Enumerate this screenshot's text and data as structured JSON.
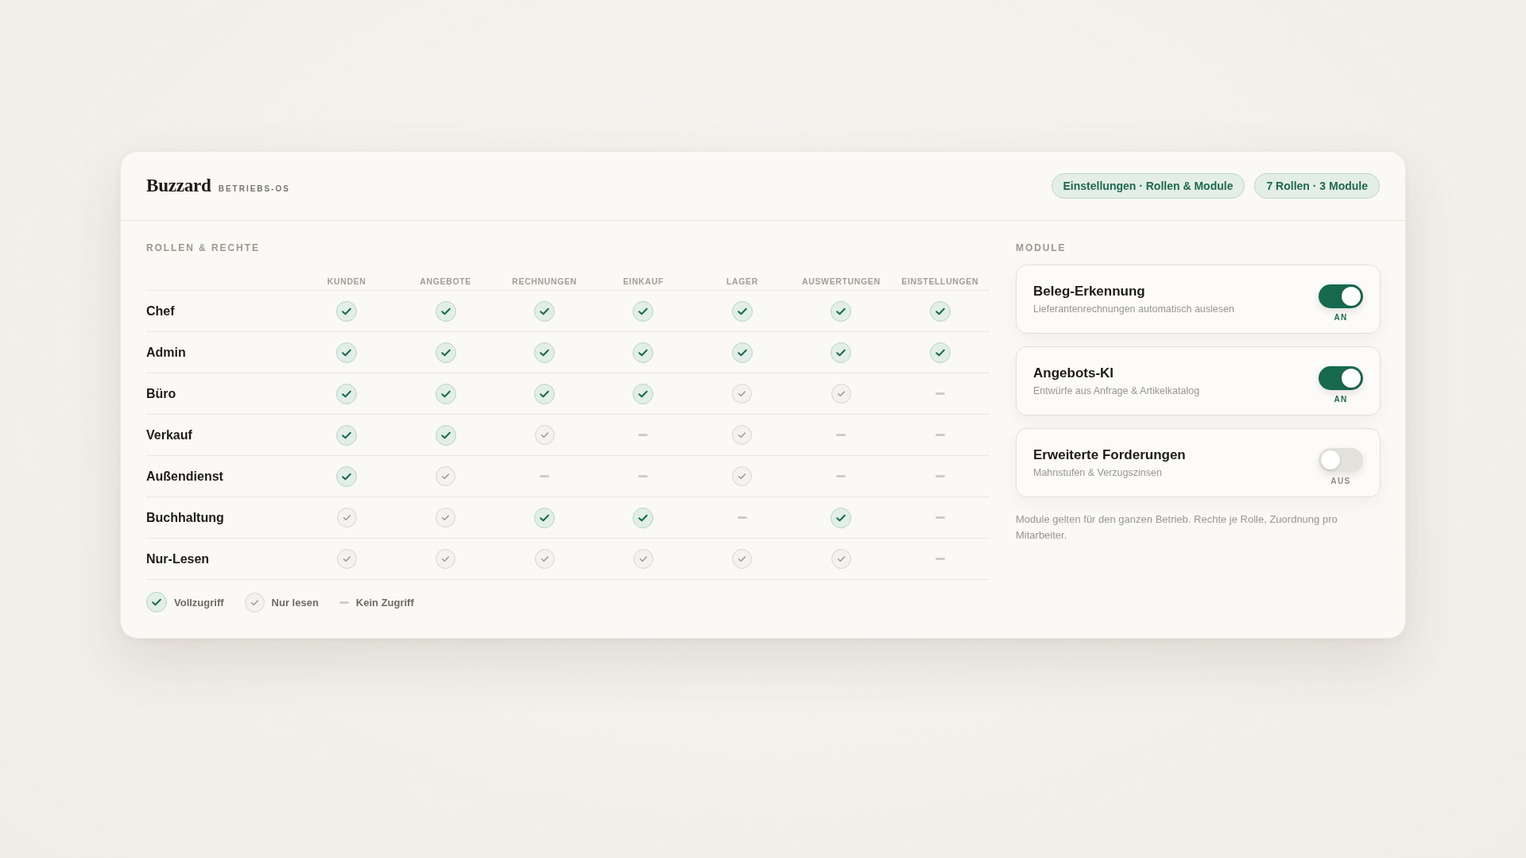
{
  "brand": {
    "name": "Buzzard",
    "tagline": "BETRIEBS-OS"
  },
  "header_badges": [
    "Einstellungen · Rollen & Module",
    "7 Rollen · 3 Module"
  ],
  "permissions": {
    "title": "ROLLEN & RECHTE",
    "columns": [
      "KUNDEN",
      "ANGEBOTE",
      "RECHNUNGEN",
      "EINKAUF",
      "LAGER",
      "AUSWERTUNGEN",
      "EINSTELLUNGEN"
    ],
    "rows": [
      {
        "role": "Chef",
        "cells": [
          {
            "kind": "full"
          },
          {
            "kind": "full"
          },
          {
            "kind": "full"
          },
          {
            "kind": "full"
          },
          {
            "kind": "full"
          },
          {
            "kind": "full"
          },
          {
            "kind": "full"
          }
        ]
      },
      {
        "role": "Admin",
        "cells": [
          {
            "kind": "full"
          },
          {
            "kind": "full"
          },
          {
            "kind": "full"
          },
          {
            "kind": "full"
          },
          {
            "kind": "full"
          },
          {
            "kind": "full"
          },
          {
            "kind": "full"
          }
        ]
      },
      {
        "role": "Büro",
        "cells": [
          {
            "kind": "full"
          },
          {
            "kind": "full"
          },
          {
            "kind": "full"
          },
          {
            "kind": "full"
          },
          {
            "kind": "read"
          },
          {
            "kind": "read"
          },
          {
            "kind": "none"
          }
        ]
      },
      {
        "role": "Verkauf",
        "cells": [
          {
            "kind": "full"
          },
          {
            "kind": "full"
          },
          {
            "kind": "read"
          },
          {
            "kind": "none"
          },
          {
            "kind": "read"
          },
          {
            "kind": "none"
          },
          {
            "kind": "none"
          }
        ]
      },
      {
        "role": "Außendienst",
        "cells": [
          {
            "kind": "full"
          },
          {
            "kind": "read"
          },
          {
            "kind": "none"
          },
          {
            "kind": "none"
          },
          {
            "kind": "read"
          },
          {
            "kind": "none"
          },
          {
            "kind": "none"
          }
        ]
      },
      {
        "role": "Buchhaltung",
        "cells": [
          {
            "kind": "read"
          },
          {
            "kind": "read"
          },
          {
            "kind": "full"
          },
          {
            "kind": "full"
          },
          {
            "kind": "none"
          },
          {
            "kind": "full"
          },
          {
            "kind": "none"
          }
        ]
      },
      {
        "role": "Nur-Lesen",
        "cells": [
          {
            "kind": "read"
          },
          {
            "kind": "read"
          },
          {
            "kind": "read"
          },
          {
            "kind": "read"
          },
          {
            "kind": "read"
          },
          {
            "kind": "read"
          },
          {
            "kind": "none"
          }
        ]
      }
    ],
    "legend": [
      {
        "kind": "full",
        "label": "Vollzugriff"
      },
      {
        "kind": "read",
        "label": "Nur lesen"
      },
      {
        "kind": "none",
        "label": "Kein Zugriff"
      }
    ]
  },
  "modules": {
    "title": "MODULE",
    "items": [
      {
        "name": "Beleg-Erkennung",
        "description": "Lieferantenrechnungen automatisch auslesen",
        "on": true,
        "state_label": "AN"
      },
      {
        "name": "Angebots-KI",
        "description": "Entwürfe aus Anfrage & Artikelkatalog",
        "on": true,
        "state_label": "AN"
      },
      {
        "name": "Erweiterte Forderungen",
        "description": "Mahnstufen & Verzugszinsen",
        "on": false,
        "state_label": "AUS"
      }
    ],
    "note": "Module gelten für den ganzen Betrieb. Rechte je Rolle, Zuordnung pro Mitarbeiter."
  }
}
